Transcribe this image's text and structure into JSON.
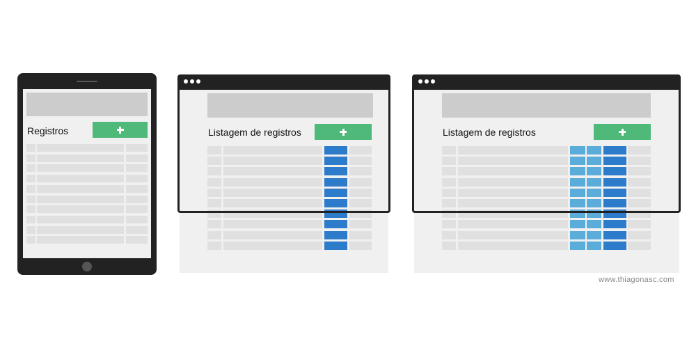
{
  "tablet": {
    "title": "Registros",
    "add_button_icon": "plus-icon",
    "rows": 10
  },
  "desktop_small": {
    "title": "Listagem de registros",
    "add_button_icon": "plus-icon",
    "rows": 10
  },
  "desktop_large": {
    "title": "Listagem de registros",
    "add_button_icon": "plus-icon",
    "rows": 10
  },
  "credit": "www.thiagonasc.com",
  "colors": {
    "device_frame": "#222222",
    "page_background": "#f0f0f0",
    "header_block": "#cccccc",
    "table_cell": "#e0e0e0",
    "add_button": "#4fb97a",
    "action_column_dark_blue": "#2d7bcb",
    "action_column_light_blue": "#5aaddb"
  }
}
